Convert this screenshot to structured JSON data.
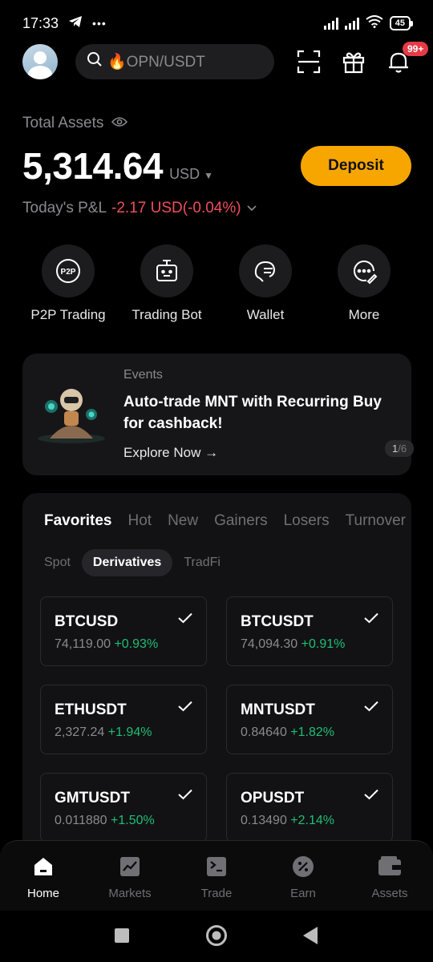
{
  "status": {
    "time": "17:33",
    "dots": "•••",
    "battery": "45"
  },
  "search": {
    "placeholder": "🔥OPN/USDT"
  },
  "notifications": {
    "badge": "99+"
  },
  "assets": {
    "label": "Total Assets",
    "value": "5,314.64",
    "currency": "USD",
    "pnl_label": "Today's P&L",
    "pnl_value": "-2.17 USD(-0.04%)",
    "deposit_label": "Deposit"
  },
  "actions": [
    {
      "label": "P2P Trading",
      "icon": "p2p-icon"
    },
    {
      "label": "Trading Bot",
      "icon": "robot-icon"
    },
    {
      "label": "Wallet",
      "icon": "wallet-icon"
    },
    {
      "label": "More",
      "icon": "more-icon"
    }
  ],
  "events": {
    "label": "Events",
    "title": "Auto-trade MNT with Recurring Buy for cashback!",
    "link": "Explore Now →",
    "page_current": "1",
    "page_total": "/6"
  },
  "market": {
    "tabs": [
      "Favorites",
      "Hot",
      "New",
      "Gainers",
      "Losers",
      "Turnover"
    ],
    "active_tab": "Favorites",
    "subtabs": [
      "Spot",
      "Derivatives",
      "TradFi"
    ],
    "active_subtab": "Derivatives",
    "cards": [
      {
        "symbol": "BTCUSD",
        "price": "74,119.00",
        "change": "+0.93%"
      },
      {
        "symbol": "BTCUSDT",
        "price": "74,094.30",
        "change": "+0.91%"
      },
      {
        "symbol": "ETHUSDT",
        "price": "2,327.24",
        "change": "+1.94%"
      },
      {
        "symbol": "MNTUSDT",
        "price": "0.84640",
        "change": "+1.82%"
      },
      {
        "symbol": "GMTUSDT",
        "price": "0.011880",
        "change": "+1.50%"
      },
      {
        "symbol": "OPUSDT",
        "price": "0.13490",
        "change": "+2.14%"
      }
    ]
  },
  "nav": [
    {
      "label": "Home",
      "icon": "home-icon"
    },
    {
      "label": "Markets",
      "icon": "chart-icon"
    },
    {
      "label": "Trade",
      "icon": "trade-icon"
    },
    {
      "label": "Earn",
      "icon": "percent-icon"
    },
    {
      "label": "Assets",
      "icon": "wallet-icon"
    }
  ],
  "colors": {
    "accent": "#f7a600",
    "positive": "#1fbf75",
    "negative": "#ef4f5a",
    "badge": "#e53b46"
  }
}
